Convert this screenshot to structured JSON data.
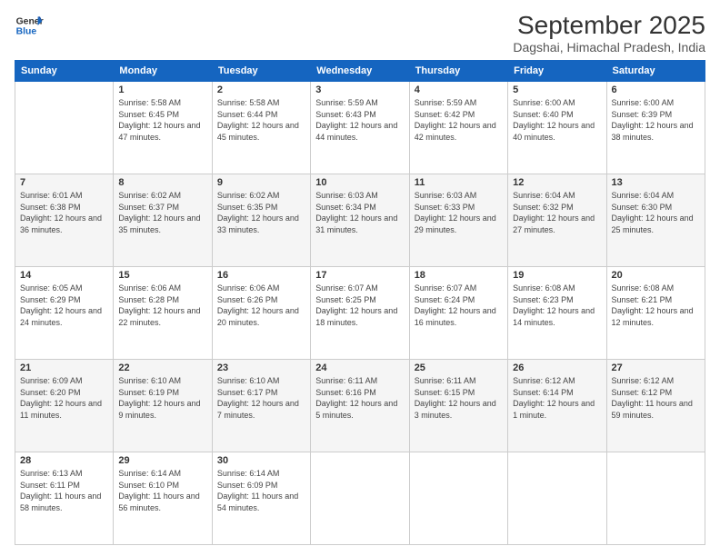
{
  "header": {
    "logo": {
      "line1": "General",
      "line2": "Blue"
    },
    "title": "September 2025",
    "subtitle": "Dagshai, Himachal Pradesh, India"
  },
  "calendar": {
    "days_of_week": [
      "Sunday",
      "Monday",
      "Tuesday",
      "Wednesday",
      "Thursday",
      "Friday",
      "Saturday"
    ],
    "weeks": [
      [
        {
          "day": "",
          "sunrise": "",
          "sunset": "",
          "daylight": ""
        },
        {
          "day": "1",
          "sunrise": "Sunrise: 5:58 AM",
          "sunset": "Sunset: 6:45 PM",
          "daylight": "Daylight: 12 hours and 47 minutes."
        },
        {
          "day": "2",
          "sunrise": "Sunrise: 5:58 AM",
          "sunset": "Sunset: 6:44 PM",
          "daylight": "Daylight: 12 hours and 45 minutes."
        },
        {
          "day": "3",
          "sunrise": "Sunrise: 5:59 AM",
          "sunset": "Sunset: 6:43 PM",
          "daylight": "Daylight: 12 hours and 44 minutes."
        },
        {
          "day": "4",
          "sunrise": "Sunrise: 5:59 AM",
          "sunset": "Sunset: 6:42 PM",
          "daylight": "Daylight: 12 hours and 42 minutes."
        },
        {
          "day": "5",
          "sunrise": "Sunrise: 6:00 AM",
          "sunset": "Sunset: 6:40 PM",
          "daylight": "Daylight: 12 hours and 40 minutes."
        },
        {
          "day": "6",
          "sunrise": "Sunrise: 6:00 AM",
          "sunset": "Sunset: 6:39 PM",
          "daylight": "Daylight: 12 hours and 38 minutes."
        }
      ],
      [
        {
          "day": "7",
          "sunrise": "Sunrise: 6:01 AM",
          "sunset": "Sunset: 6:38 PM",
          "daylight": "Daylight: 12 hours and 36 minutes."
        },
        {
          "day": "8",
          "sunrise": "Sunrise: 6:02 AM",
          "sunset": "Sunset: 6:37 PM",
          "daylight": "Daylight: 12 hours and 35 minutes."
        },
        {
          "day": "9",
          "sunrise": "Sunrise: 6:02 AM",
          "sunset": "Sunset: 6:35 PM",
          "daylight": "Daylight: 12 hours and 33 minutes."
        },
        {
          "day": "10",
          "sunrise": "Sunrise: 6:03 AM",
          "sunset": "Sunset: 6:34 PM",
          "daylight": "Daylight: 12 hours and 31 minutes."
        },
        {
          "day": "11",
          "sunrise": "Sunrise: 6:03 AM",
          "sunset": "Sunset: 6:33 PM",
          "daylight": "Daylight: 12 hours and 29 minutes."
        },
        {
          "day": "12",
          "sunrise": "Sunrise: 6:04 AM",
          "sunset": "Sunset: 6:32 PM",
          "daylight": "Daylight: 12 hours and 27 minutes."
        },
        {
          "day": "13",
          "sunrise": "Sunrise: 6:04 AM",
          "sunset": "Sunset: 6:30 PM",
          "daylight": "Daylight: 12 hours and 25 minutes."
        }
      ],
      [
        {
          "day": "14",
          "sunrise": "Sunrise: 6:05 AM",
          "sunset": "Sunset: 6:29 PM",
          "daylight": "Daylight: 12 hours and 24 minutes."
        },
        {
          "day": "15",
          "sunrise": "Sunrise: 6:06 AM",
          "sunset": "Sunset: 6:28 PM",
          "daylight": "Daylight: 12 hours and 22 minutes."
        },
        {
          "day": "16",
          "sunrise": "Sunrise: 6:06 AM",
          "sunset": "Sunset: 6:26 PM",
          "daylight": "Daylight: 12 hours and 20 minutes."
        },
        {
          "day": "17",
          "sunrise": "Sunrise: 6:07 AM",
          "sunset": "Sunset: 6:25 PM",
          "daylight": "Daylight: 12 hours and 18 minutes."
        },
        {
          "day": "18",
          "sunrise": "Sunrise: 6:07 AM",
          "sunset": "Sunset: 6:24 PM",
          "daylight": "Daylight: 12 hours and 16 minutes."
        },
        {
          "day": "19",
          "sunrise": "Sunrise: 6:08 AM",
          "sunset": "Sunset: 6:23 PM",
          "daylight": "Daylight: 12 hours and 14 minutes."
        },
        {
          "day": "20",
          "sunrise": "Sunrise: 6:08 AM",
          "sunset": "Sunset: 6:21 PM",
          "daylight": "Daylight: 12 hours and 12 minutes."
        }
      ],
      [
        {
          "day": "21",
          "sunrise": "Sunrise: 6:09 AM",
          "sunset": "Sunset: 6:20 PM",
          "daylight": "Daylight: 12 hours and 11 minutes."
        },
        {
          "day": "22",
          "sunrise": "Sunrise: 6:10 AM",
          "sunset": "Sunset: 6:19 PM",
          "daylight": "Daylight: 12 hours and 9 minutes."
        },
        {
          "day": "23",
          "sunrise": "Sunrise: 6:10 AM",
          "sunset": "Sunset: 6:17 PM",
          "daylight": "Daylight: 12 hours and 7 minutes."
        },
        {
          "day": "24",
          "sunrise": "Sunrise: 6:11 AM",
          "sunset": "Sunset: 6:16 PM",
          "daylight": "Daylight: 12 hours and 5 minutes."
        },
        {
          "day": "25",
          "sunrise": "Sunrise: 6:11 AM",
          "sunset": "Sunset: 6:15 PM",
          "daylight": "Daylight: 12 hours and 3 minutes."
        },
        {
          "day": "26",
          "sunrise": "Sunrise: 6:12 AM",
          "sunset": "Sunset: 6:14 PM",
          "daylight": "Daylight: 12 hours and 1 minute."
        },
        {
          "day": "27",
          "sunrise": "Sunrise: 6:12 AM",
          "sunset": "Sunset: 6:12 PM",
          "daylight": "Daylight: 11 hours and 59 minutes."
        }
      ],
      [
        {
          "day": "28",
          "sunrise": "Sunrise: 6:13 AM",
          "sunset": "Sunset: 6:11 PM",
          "daylight": "Daylight: 11 hours and 58 minutes."
        },
        {
          "day": "29",
          "sunrise": "Sunrise: 6:14 AM",
          "sunset": "Sunset: 6:10 PM",
          "daylight": "Daylight: 11 hours and 56 minutes."
        },
        {
          "day": "30",
          "sunrise": "Sunrise: 6:14 AM",
          "sunset": "Sunset: 6:09 PM",
          "daylight": "Daylight: 11 hours and 54 minutes."
        },
        {
          "day": "",
          "sunrise": "",
          "sunset": "",
          "daylight": ""
        },
        {
          "day": "",
          "sunrise": "",
          "sunset": "",
          "daylight": ""
        },
        {
          "day": "",
          "sunrise": "",
          "sunset": "",
          "daylight": ""
        },
        {
          "day": "",
          "sunrise": "",
          "sunset": "",
          "daylight": ""
        }
      ]
    ]
  }
}
